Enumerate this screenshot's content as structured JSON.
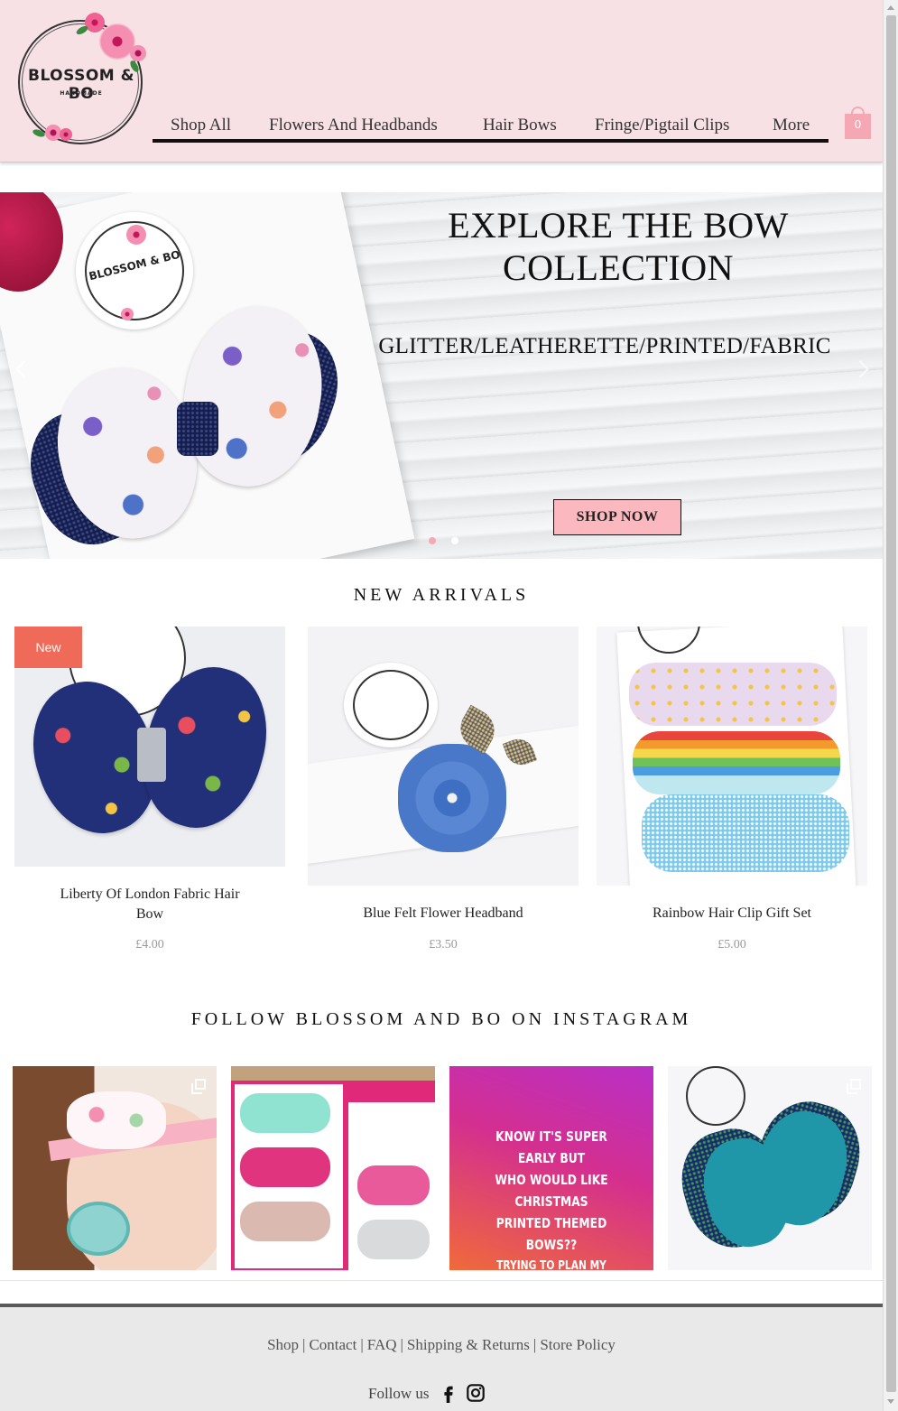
{
  "brand": {
    "logo_main": "BLOSSOM & BO",
    "logo_sub": "HANDMADE"
  },
  "nav": {
    "items": [
      "Shop All",
      "Flowers And Headbands",
      "Hair Bows",
      "Fringe/Pigtail Clips",
      "More"
    ]
  },
  "cart": {
    "count": "0",
    "icon": "shopping-bag-icon"
  },
  "hero": {
    "title_line1": "EXPLORE THE BOW",
    "title_line2": "COLLECTION",
    "subtitle": "GLITTER/LEATHERETTE/PRINTED/FABRIC",
    "cta": "SHOP NOW",
    "sticker_text": "BLOSSOM & BO",
    "active_slide": 1,
    "slide_count": 2
  },
  "new_arrivals": {
    "title": "NEW ARRIVALS",
    "badge": "New",
    "products": [
      {
        "name_line1": "Liberty Of London Fabric Hair",
        "name_line2": "Bow",
        "price": "£4.00"
      },
      {
        "name": "Blue Felt Flower Headband",
        "price": "£3.50"
      },
      {
        "name": "Rainbow Hair Clip Gift Set",
        "price": "£5.00"
      }
    ]
  },
  "instagram": {
    "title": "FOLLOW BLOSSOM AND BO ON INSTAGRAM",
    "post_text": [
      "KNOW IT'S SUPER EARLY BUT",
      "WHO WOULD LIKE CHRISTMAS",
      "PRINTED THEMED BOWS??",
      "TRYING TO PLAN MY FABRICS 😃"
    ]
  },
  "footer": {
    "links": [
      "Shop",
      "Contact",
      "FAQ",
      "Shipping & Returns",
      "Store Policy"
    ],
    "follow_label": "Follow us"
  },
  "colors": {
    "header_bg": "#f7e1e5",
    "cta_bg": "#fbb9bf",
    "badge_bg": "#f06a5a",
    "cart": "#f5a8b4"
  }
}
